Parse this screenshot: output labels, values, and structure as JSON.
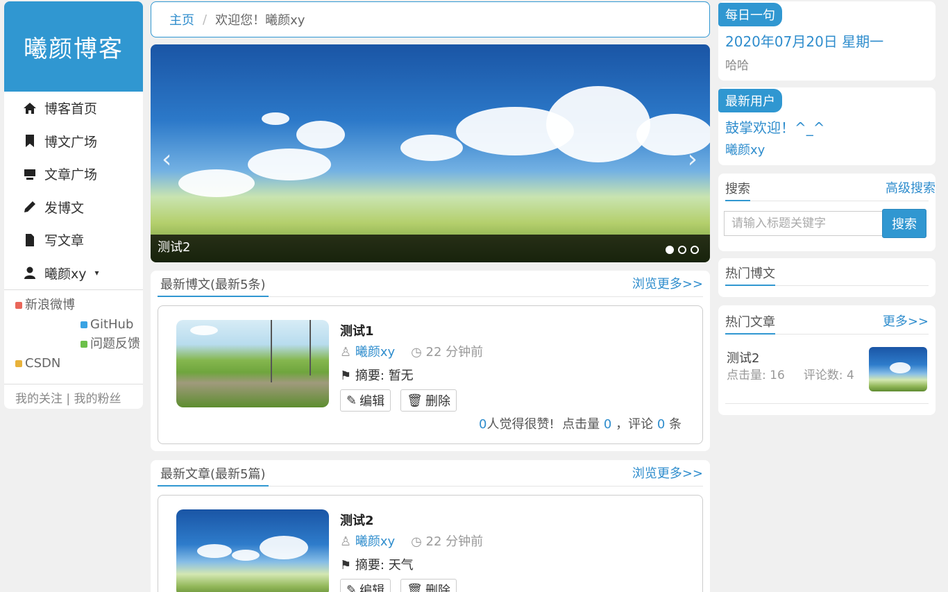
{
  "sidebar": {
    "logo": "曦颜博客",
    "items": [
      {
        "label": "博客首页",
        "icon": "home-icon"
      },
      {
        "label": "博文广场",
        "icon": "bookmark-icon"
      },
      {
        "label": "文章广场",
        "icon": "monitor-icon"
      },
      {
        "label": "发博文",
        "icon": "pencil-icon"
      },
      {
        "label": "写文章",
        "icon": "document-icon"
      },
      {
        "label": "曦颜xy",
        "icon": "user-icon"
      }
    ],
    "links": [
      {
        "label": "新浪微博",
        "color": "#e9665a"
      },
      {
        "label": "GitHub",
        "color": "#3aa3e3"
      },
      {
        "label": "问题反馈",
        "color": "#6cc04a"
      },
      {
        "label": "CSDN",
        "color": "#e8b23a"
      }
    ],
    "follow": "我的关注",
    "fans": "我的粉丝",
    "follow_sep": "|"
  },
  "breadcrumb": {
    "home": "主页",
    "sep": "/",
    "current": "欢迎您！曦颜xy"
  },
  "carousel": {
    "caption": "测试2",
    "prev": "‹",
    "next": "›",
    "slides": 3,
    "active": 1
  },
  "latest_posts": {
    "title": "最新博文(最新5条)",
    "more": "浏览更多>>",
    "items": [
      {
        "title": "测试1",
        "author": "曦颜xy",
        "time": "22 分钟前",
        "summary_label": "摘要:",
        "summary": "暂无",
        "edit": "编辑",
        "delete": "删除",
        "likes": "0",
        "likes_text": "人觉得很赞!",
        "views_label": "点击量",
        "views": "0",
        "comments_label": "，评论",
        "comments": "0",
        "comments_unit": "条"
      }
    ]
  },
  "latest_articles": {
    "title": "最新文章(最新5篇)",
    "more": "浏览更多>>",
    "items": [
      {
        "title": "测试2",
        "author": "曦颜xy",
        "time": "22 分钟前",
        "summary_label": "摘要:",
        "summary": "天气",
        "edit": "编辑",
        "delete": "删除"
      }
    ]
  },
  "daily": {
    "tag": "每日一句",
    "date": "2020年07月20日 星期一",
    "quote": "哈哈"
  },
  "newest_user": {
    "tag": "最新用户",
    "welcome": "鼓掌欢迎！^_^",
    "user": "曦颜xy"
  },
  "search": {
    "title": "搜索",
    "advanced": "高级搜索",
    "placeholder": "请输入标题关键字",
    "button": "搜索"
  },
  "hot_posts": {
    "title": "热门博文"
  },
  "hot_articles": {
    "title": "热门文章",
    "more": "更多>>",
    "items": [
      {
        "title": "测试2",
        "views_label": "点击量:",
        "views": "16",
        "comments_label": "评论数:",
        "comments": "4"
      }
    ]
  },
  "colors": {
    "accent": "#3097d1",
    "link": "#2f8dcd",
    "background": "#f0f0f0"
  }
}
